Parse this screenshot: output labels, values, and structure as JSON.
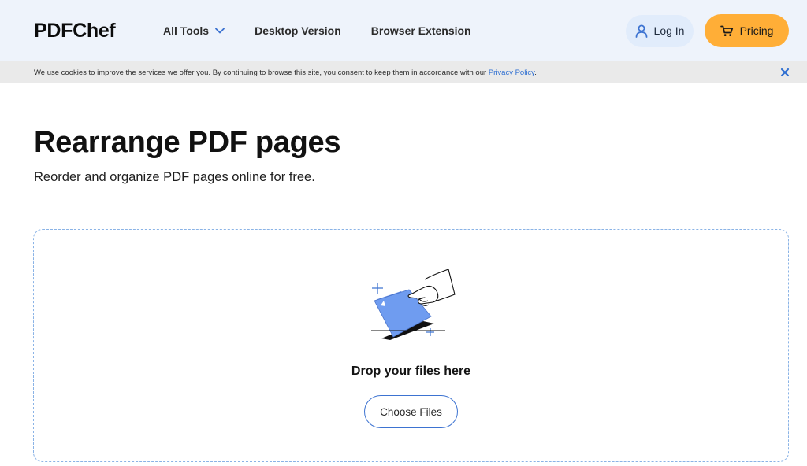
{
  "header": {
    "logo": "PDFChef",
    "nav": {
      "all_tools": "All Tools",
      "desktop_version": "Desktop Version",
      "browser_extension": "Browser Extension"
    },
    "login_label": "Log In",
    "pricing_label": "Pricing"
  },
  "cookie_bar": {
    "text": "We use cookies to improve the services we offer you. By continuing to browse this site, you consent to keep them in accordance with our ",
    "link_text": "Privacy Policy",
    "suffix": "."
  },
  "hero": {
    "title": "Rearrange PDF pages",
    "subtitle": "Reorder and organize PDF pages online for free."
  },
  "dropzone": {
    "prompt": "Drop your files here",
    "button_label": "Choose Files"
  },
  "colors": {
    "header_bg": "#eef3fb",
    "accent_blue": "#3d73d1",
    "pricing_orange": "#ffae37",
    "folder_blue": "#6f9cf0"
  },
  "icons": {
    "chevron": "chevron-down-icon",
    "user": "user-icon",
    "cart": "cart-icon",
    "close": "close-icon",
    "illustration": "upload-folder-illustration"
  }
}
